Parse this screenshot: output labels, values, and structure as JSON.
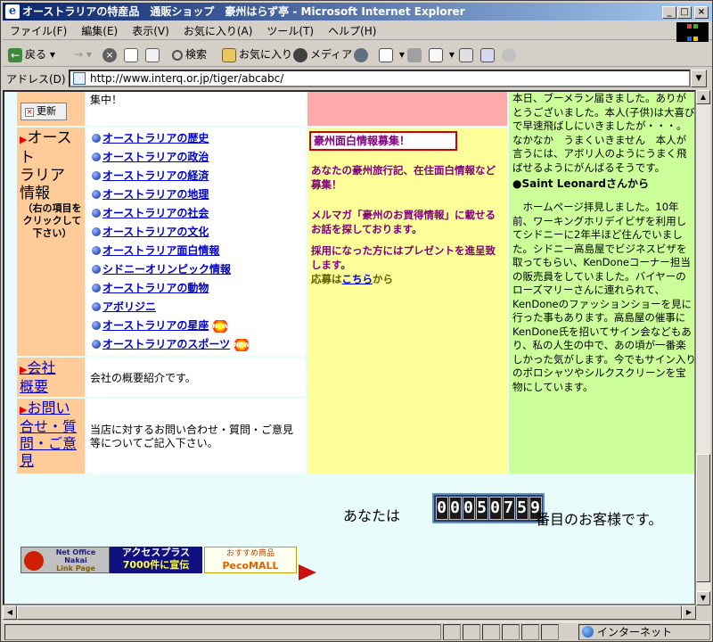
{
  "window": {
    "title": "オーストラリアの特産品　通販ショップ　豪州はらず亭 - Microsoft Internet Explorer",
    "min_label": "_",
    "max_label": "□",
    "close_label": "×"
  },
  "menu": [
    "ファイル(F)",
    "編集(E)",
    "表示(V)",
    "お気に入り(A)",
    "ツール(T)",
    "ヘルプ(H)"
  ],
  "toolbar": {
    "back": "戻る",
    "search": "検索",
    "favorites": "お気に入り",
    "media": "メディア"
  },
  "address": {
    "label": "アドレス(D)",
    "url": "http://www.interq.or.jp/tiger/abcabc/"
  },
  "page": {
    "top_center_text": "集中！",
    "refresh_label": "更新",
    "australia_section": {
      "title_lines": [
        "オースト",
        "ラリア",
        "情報"
      ],
      "note": "（右の項目をクリックして下さい）",
      "links": [
        "オーストラリアの歴史",
        "オーストラリアの政治",
        "オーストラリアの経済",
        "オーストラリアの地理",
        "オーストラリアの社会",
        "オーストラリアの文化",
        "オーストラリア面白情報",
        "シドニーオリンピック情報",
        "オーストラリアの動物",
        "アボリジニ",
        "オーストラリアの星座",
        "オーストラリアのスポーツ"
      ],
      "new_badge": "NEW"
    },
    "middle": {
      "boxed_title": "豪州面白情報募集！",
      "para1": "あなたの豪州旅行記、在住面白情報など募集！",
      "para2": "メルマガ「豪州のお買得情報」に載せるお話を探しております。",
      "para3": "採用になった方にはプレゼントを進呈致します。",
      "apply_prefix": "応募は",
      "apply_link": "こちら",
      "apply_suffix": "から"
    },
    "right": {
      "para1": "本日、ブーメラン届きました。ありがとうございました。本人(子供)は大喜びで早速飛ばしにいきましたが・・・。なかなか　うまくいきません　本人が言うには、アボリ人のようにうまく飛ばせるようにがんばるそうです。",
      "heading": "●Saint Leonardさんから",
      "para2": "　ホームページ拝見しました。10年前、ワーキングホリデイビザを利用してシドニーに2年半ほど住んでいました。シドニー高島屋でビジネスビザを取ってもらい、KenDoneコーナー担当の販売員をしていました。バイヤーのローズマリーさんに連れられて、KenDoneのファッションショーを見に行った事もあります。高島屋の催事にKenDone氏を招いてサイン会などもあり、私の人生の中で、あの頃が一番楽しかった気がします。今でもサイン入りのポロシャツやシルクスクリーンを宝物にしています。"
    },
    "company": {
      "title_lines": [
        "会社",
        "概要"
      ],
      "desc": "会社の概要紹介です。"
    },
    "contact": {
      "title_lines": [
        "お問い",
        "合せ・質",
        "問・ご意",
        "見"
      ],
      "desc": "当店に対するお問い合わせ・質問・ご意見等についてご記入下さい。"
    },
    "visitor": {
      "prefix": "あなたは",
      "count": "00050759",
      "suffix": "番目のお客様です。"
    },
    "banners": {
      "b1_lines": [
        "Net Office",
        "Nakai",
        "Link Page"
      ],
      "b2_lines": [
        "アクセスプラス",
        "7000件に宣伝"
      ],
      "b3_lines": [
        "おすすめ商品",
        "PecoMALL"
      ]
    }
  },
  "status": {
    "zone": "インターネット"
  },
  "colors": {
    "left_col": "#ffcc99",
    "middle_col": "#ffff99",
    "right_col": "#ccff99",
    "page_bg": "#e8fcfc",
    "link": "#0000cc"
  }
}
